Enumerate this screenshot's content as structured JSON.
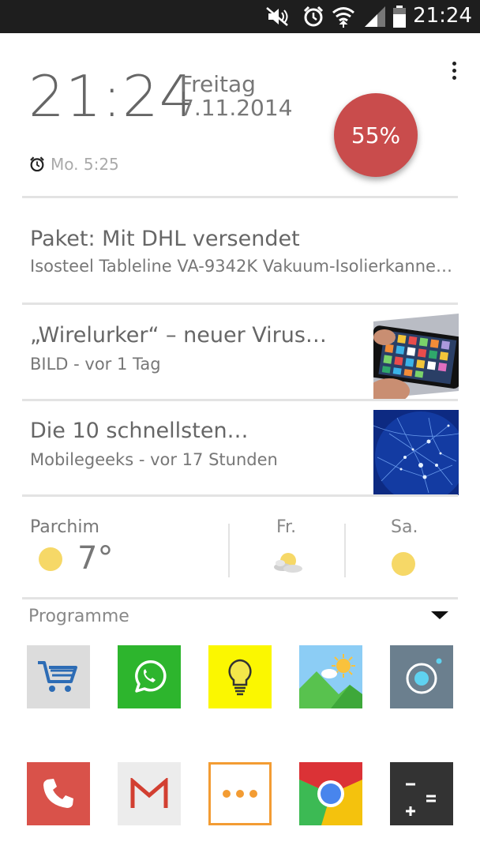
{
  "status_bar": {
    "time": "21:24",
    "icons": [
      "mute-icon",
      "alarm-icon",
      "wifi-icon",
      "signal-icon",
      "battery-icon"
    ]
  },
  "clock": {
    "time": "21:24",
    "day": "Freitag",
    "date": "7.11.2014",
    "alarm": "Mo. 5:25",
    "battery_percent": "55%"
  },
  "notification": {
    "title": "Paket: Mit DHL versendet",
    "subtitle": "Isosteel Tableline VA-9342K Vakuum-Isolierkanne…"
  },
  "news": [
    {
      "title": "„Wirelurker“ – neuer Virus…",
      "source": "BILD - vor 1 Tag",
      "image": "smartphone-photo"
    },
    {
      "title": "Die 10 schnellsten…",
      "source": "Mobilegeeks - vor 17 Stunden",
      "image": "network-globe-photo"
    }
  ],
  "weather": {
    "city": "Parchim",
    "temperature": "7°",
    "current_icon": "sun-icon",
    "forecast": [
      {
        "day": "Fr.",
        "icon": "partly-cloudy-icon"
      },
      {
        "day": "Sa.",
        "icon": "sun-icon"
      }
    ]
  },
  "programme": {
    "label": "Programme",
    "apps_row1": [
      "shopping-cart-app",
      "whatsapp-app",
      "lightbulb-app",
      "gallery-app",
      "camera-app"
    ],
    "apps_row2": [
      "phone-app",
      "gmail-app",
      "more-apps",
      "chrome-app",
      "calculator-app"
    ]
  },
  "colors": {
    "battery": "#c94c4c",
    "sun": "#f6d867",
    "whatsapp": "#2db52d",
    "lightbulb": "#fbf700",
    "phone": "#d9524a",
    "calculator": "#333333",
    "camera": "#6b7f8e"
  }
}
